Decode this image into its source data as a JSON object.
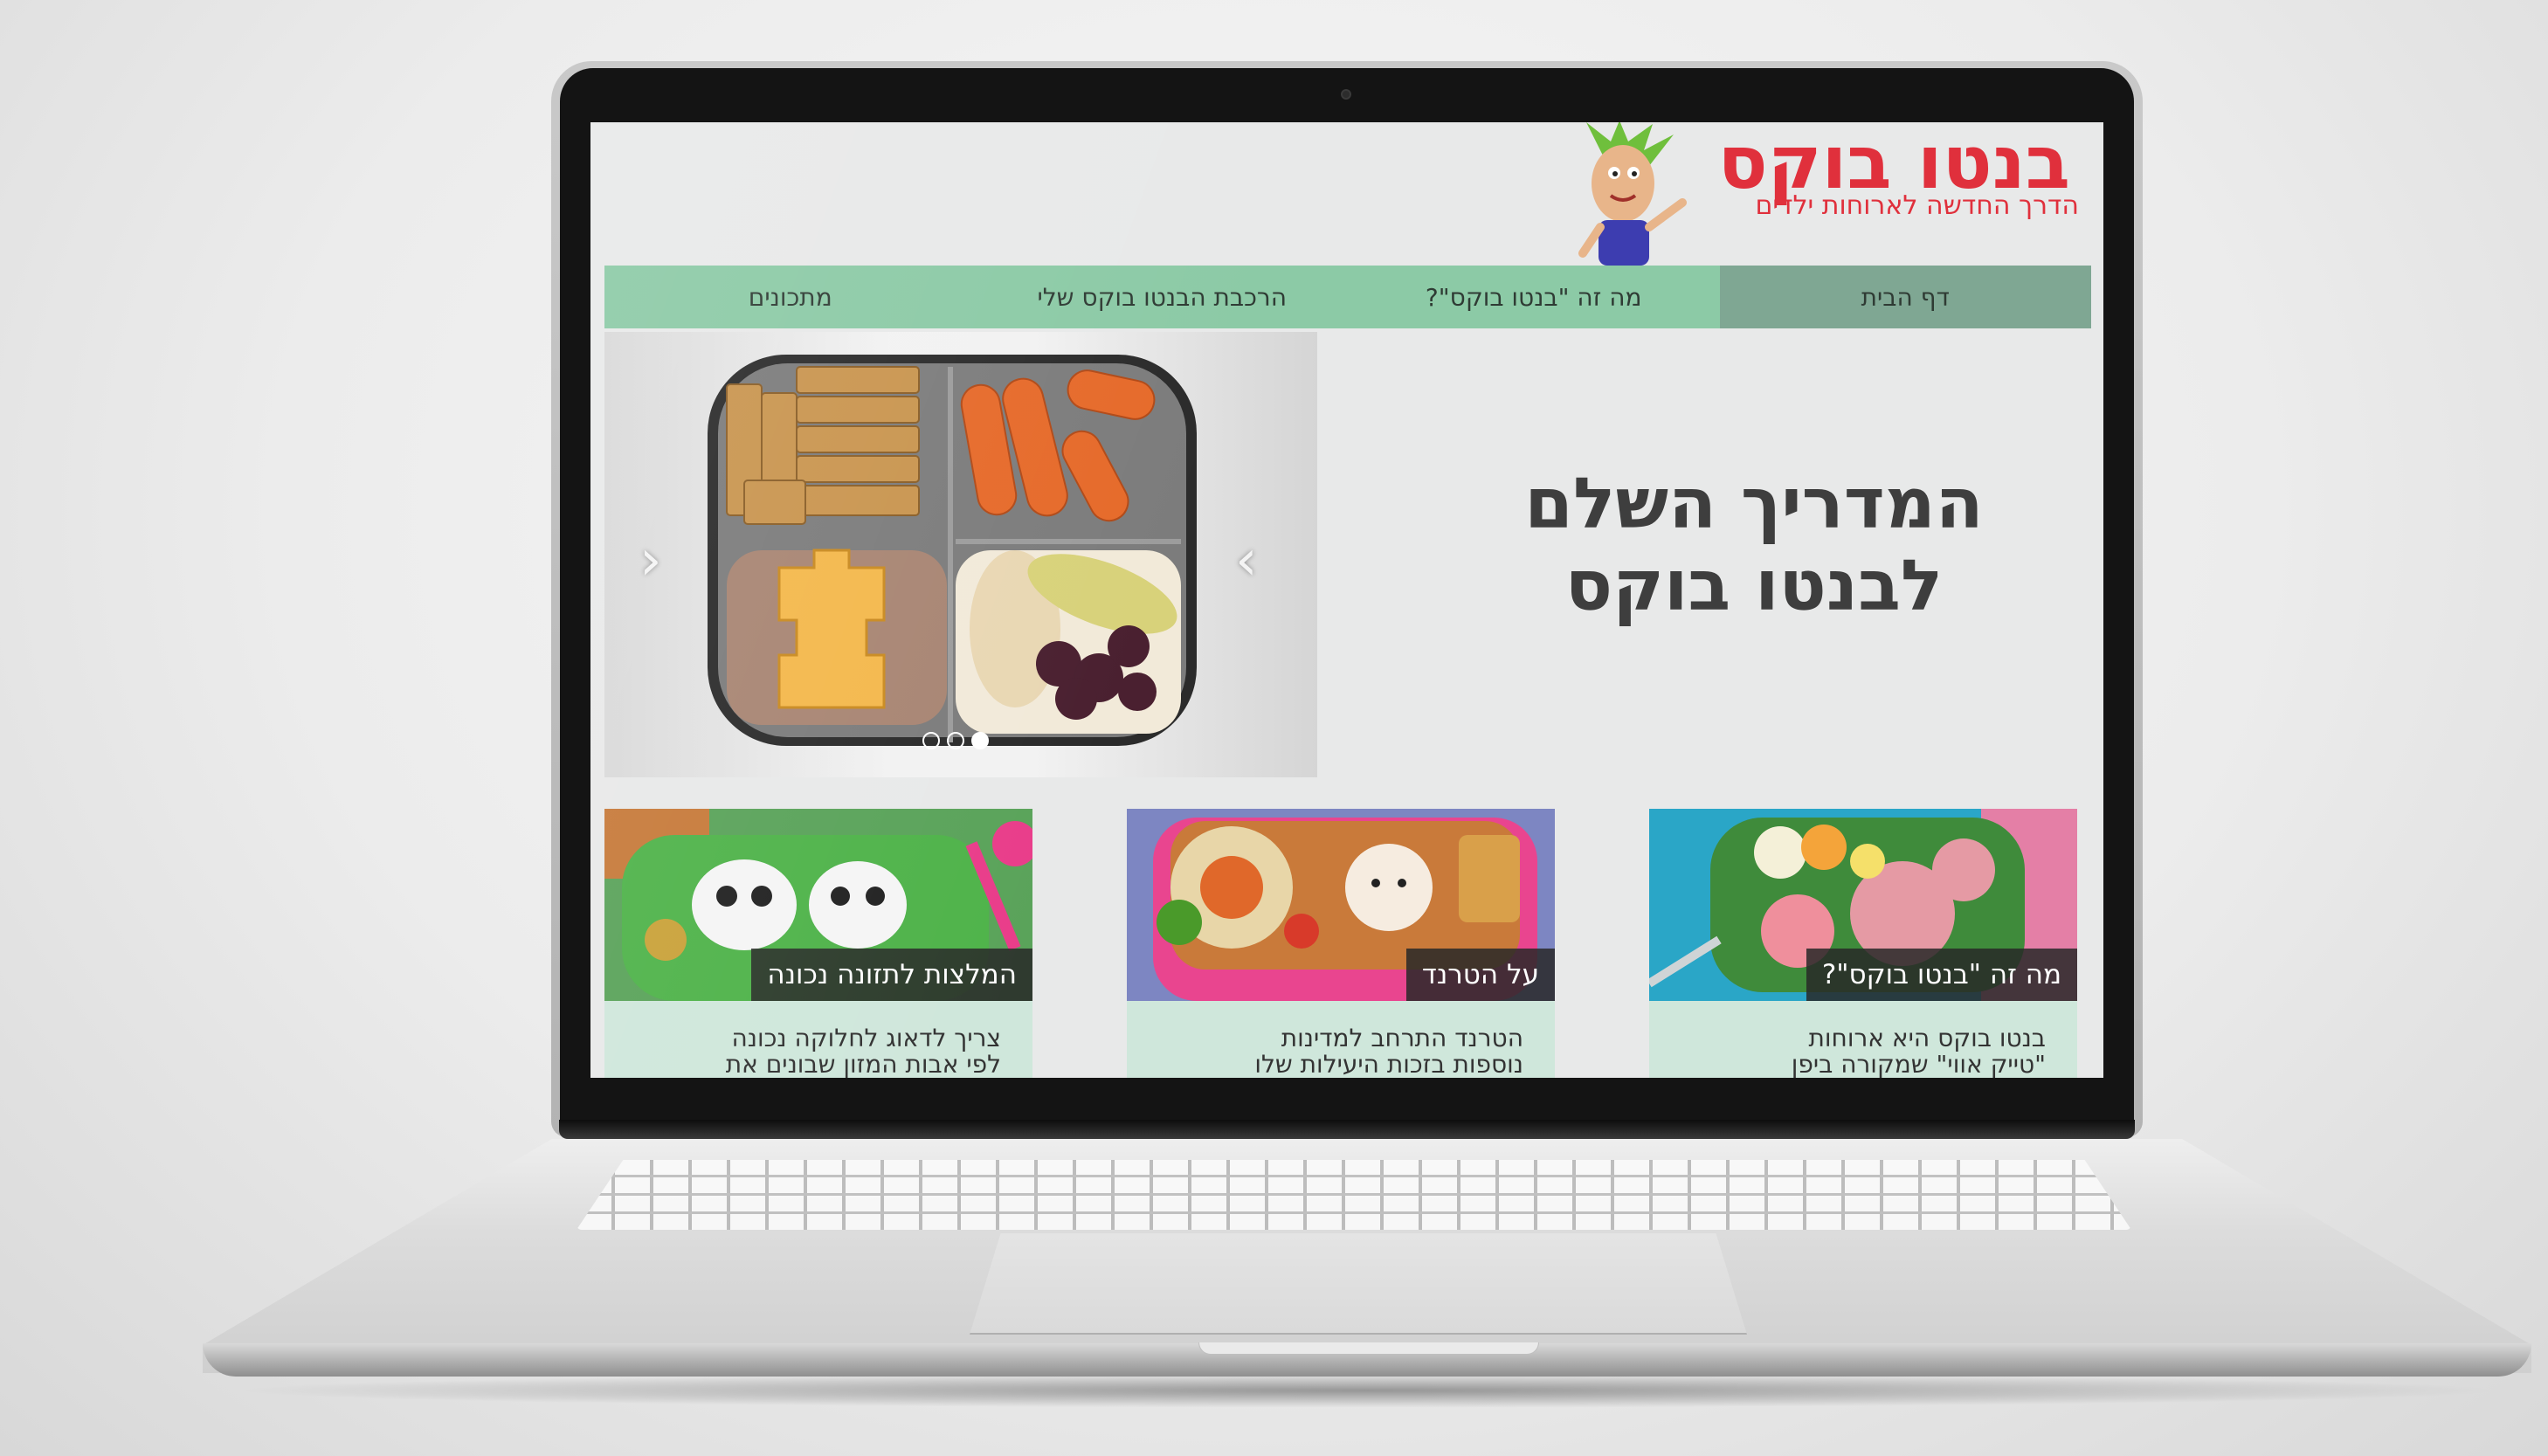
{
  "site": {
    "title": "בנטו בוקס",
    "tagline": "הדרך החדשה לארוחות ילדים"
  },
  "nav": {
    "items": [
      {
        "label": "דף הבית",
        "active": true
      },
      {
        "label": "מה זה \"בנטו בוקס\"?",
        "active": false
      },
      {
        "label": "הרכבת הבנטו בוקס שלי",
        "active": false
      },
      {
        "label": "מתכונים",
        "active": false
      }
    ]
  },
  "hero": {
    "line1": "המדריך השלם",
    "line2": "לבנטו בוקס"
  },
  "slider": {
    "prev_icon": "‹",
    "next_icon": "›",
    "slide_count": 3,
    "active_slide": 1
  },
  "cards": [
    {
      "caption": "מה זה \"בנטו בוקס\"?",
      "line1": "בנטו בוקס היא ארוחות",
      "line2": "\"טייק אווי\" שמקורה ביפן"
    },
    {
      "caption": "על הטרנד",
      "line1": "הטרנד התרחב למדינות",
      "line2": "נוספות בזכות היעילות שלו"
    },
    {
      "caption": "המלצות לתזונה נכונה",
      "line1": "צריך לדאוג לחלוקה נכונה",
      "line2": "לפי אבות המזון שבונים את"
    }
  ],
  "colors": {
    "brand_red": "#e0303c",
    "nav_green": "#8ccaa6",
    "nav_active": "#7fa793",
    "card_body": "#cfe7db"
  }
}
